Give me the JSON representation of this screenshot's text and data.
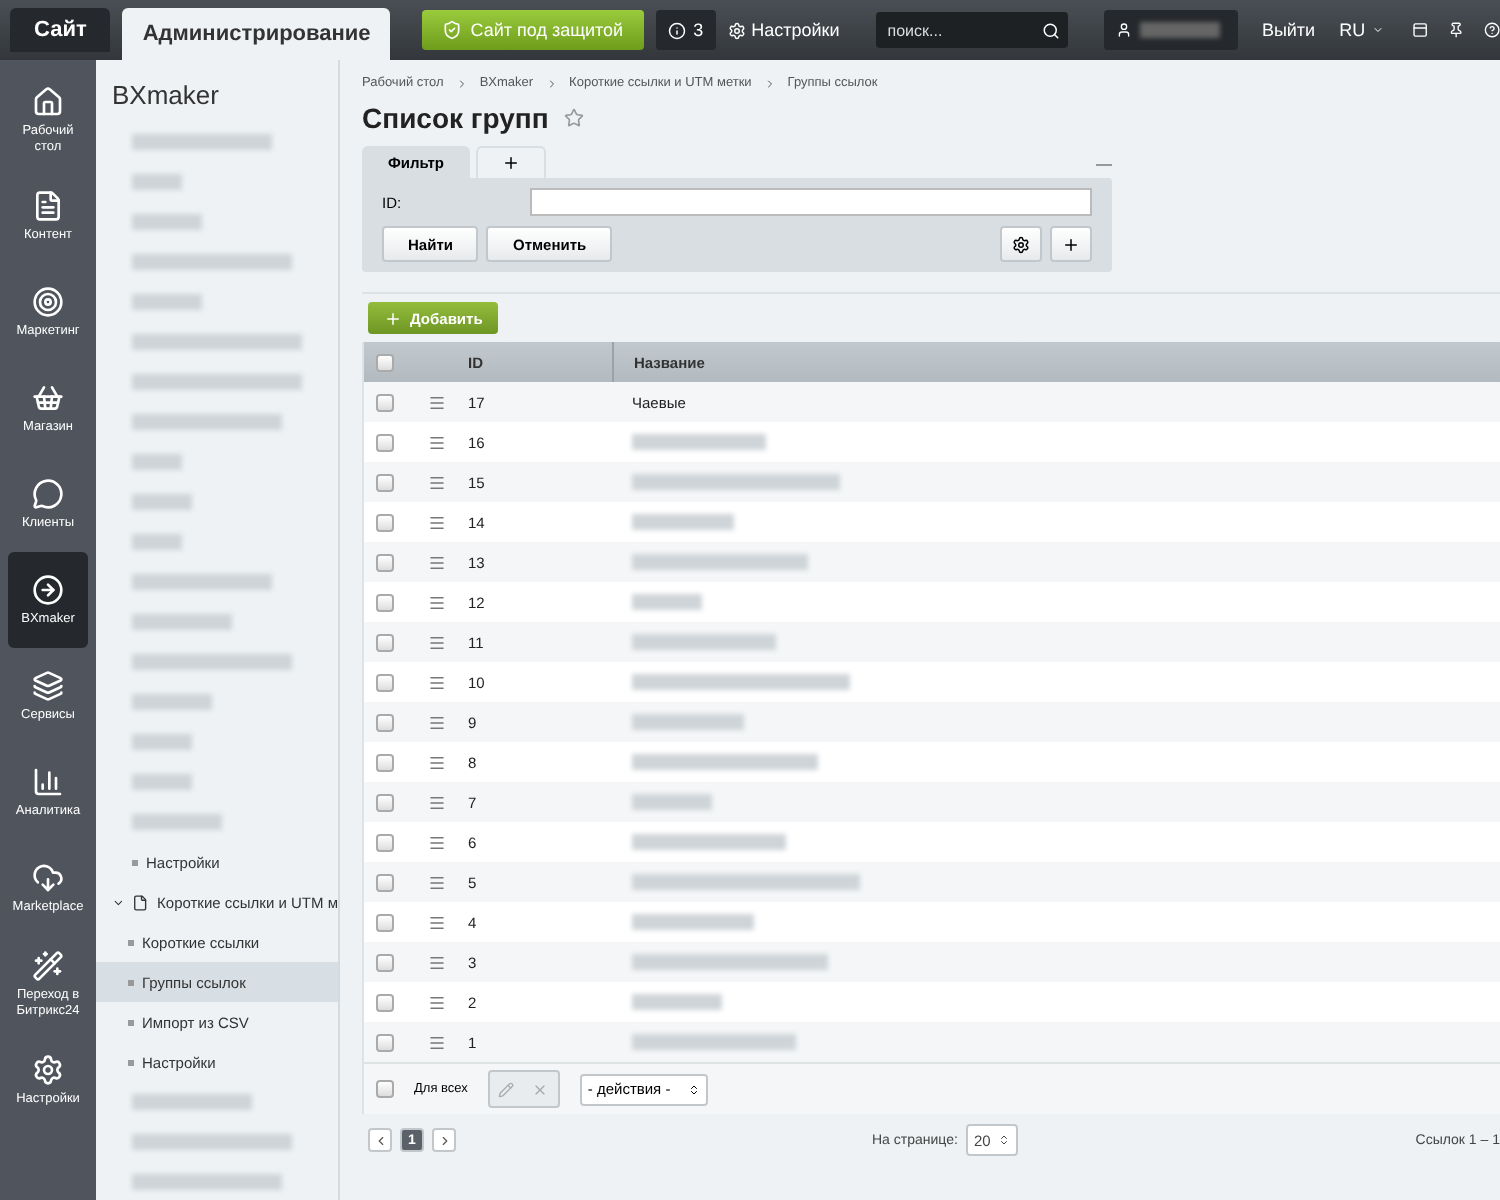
{
  "top_bar": {
    "tabs": [
      {
        "label": "Сайт",
        "selected": false
      },
      {
        "label": "Администрирование",
        "selected": true
      }
    ],
    "security_button": "Сайт под защитой",
    "notifications": "3",
    "settings": "Настройки",
    "search": {
      "placeholder": "поиск..."
    },
    "logout": "Выйти",
    "language": "RU"
  },
  "nav": [
    {
      "label": "Рабочий стол",
      "selected": false
    },
    {
      "label": "Контент",
      "selected": false
    },
    {
      "label": "Маркетинг",
      "selected": false
    },
    {
      "label": "Магазин",
      "selected": false
    },
    {
      "label": "Клиенты",
      "selected": false
    },
    {
      "label": "BXmaker",
      "selected": true
    },
    {
      "label": "Сервисы",
      "selected": false
    },
    {
      "label": "Аналитика",
      "selected": false
    },
    {
      "label": "Marketplace",
      "selected": false
    },
    {
      "label": "Переход в Битрикс24",
      "selected": false
    },
    {
      "label": "Настройки",
      "selected": false
    }
  ],
  "tree": {
    "title": "BXmaker",
    "items": [
      {
        "kind": "blurred"
      },
      {
        "kind": "blurred"
      },
      {
        "kind": "blurred"
      },
      {
        "kind": "blurred"
      },
      {
        "kind": "blurred"
      },
      {
        "kind": "blurred"
      },
      {
        "kind": "blurred"
      },
      {
        "kind": "blurred"
      },
      {
        "kind": "blurred"
      },
      {
        "kind": "blurred"
      },
      {
        "kind": "blurred"
      },
      {
        "kind": "blurred"
      },
      {
        "kind": "blurred"
      },
      {
        "kind": "blurred"
      },
      {
        "kind": "blurred"
      },
      {
        "kind": "blurred"
      },
      {
        "kind": "blurred"
      },
      {
        "kind": "blurred"
      },
      {
        "kind": "leaf",
        "label": "Настройки",
        "selected": false
      },
      {
        "kind": "folder",
        "label": "Короткие ссылки и UTM м",
        "expanded": true,
        "selected": false,
        "children": [
          {
            "kind": "leaf",
            "label": "Короткие ссылки",
            "selected": false
          },
          {
            "kind": "leaf",
            "label": "Группы ссылок",
            "selected": true
          },
          {
            "kind": "leaf",
            "label": "Импорт из CSV",
            "selected": false
          },
          {
            "kind": "leaf",
            "label": "Настройки",
            "selected": false
          }
        ]
      },
      {
        "kind": "blurred"
      },
      {
        "kind": "blurred"
      },
      {
        "kind": "blurred"
      }
    ]
  },
  "breadcrumbs": [
    "Рабочий стол",
    "BXmaker",
    "Короткие ссылки и UTM метки",
    "Группы ссылок"
  ],
  "page_title": "Список групп",
  "filter": {
    "tab": "Фильтр",
    "field_label": "ID:",
    "find_button": "Найти",
    "cancel_button": "Отменить"
  },
  "add_button": "Добавить",
  "table": {
    "all_checked": false,
    "columns": [
      "ID",
      "Название"
    ],
    "rows": [
      {
        "id": "17",
        "name": "Чаевые",
        "checked": false
      },
      {
        "id": "16",
        "checked": false
      },
      {
        "id": "15",
        "checked": false
      },
      {
        "id": "14",
        "checked": false
      },
      {
        "id": "13",
        "checked": false
      },
      {
        "id": "12",
        "checked": false
      },
      {
        "id": "11",
        "checked": false
      },
      {
        "id": "10",
        "checked": false
      },
      {
        "id": "9",
        "checked": false
      },
      {
        "id": "8",
        "checked": false
      },
      {
        "id": "7",
        "checked": false
      },
      {
        "id": "6",
        "checked": false
      },
      {
        "id": "5",
        "checked": false
      },
      {
        "id": "4",
        "checked": false
      },
      {
        "id": "3",
        "checked": false
      },
      {
        "id": "2",
        "checked": false
      },
      {
        "id": "1",
        "checked": false
      }
    ]
  },
  "footer": {
    "all_checked": false,
    "for_all": "Для всех",
    "actions": "- действия -",
    "pages": [
      {
        "label": "1",
        "selected": true
      }
    ],
    "per_page_label": "На странице:",
    "per_page": "20",
    "count": "Ссылок 1 – 1"
  }
}
